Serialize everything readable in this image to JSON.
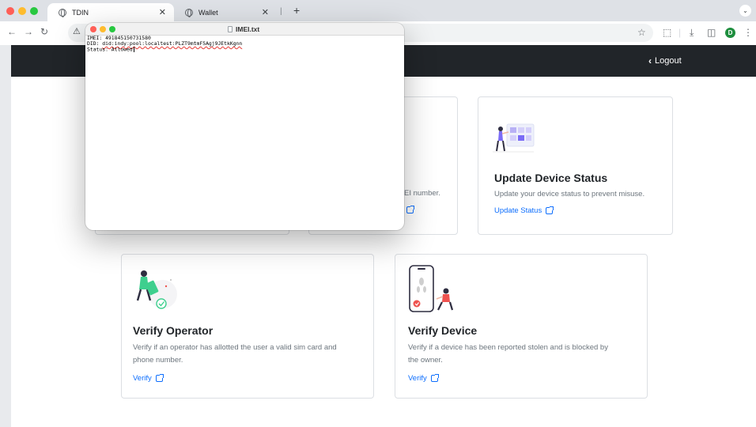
{
  "browser": {
    "tabs": [
      {
        "label": "TDIN",
        "active": true
      },
      {
        "label": "Wallet",
        "active": false
      }
    ],
    "address_warning_icon": "warning-icon",
    "profile_initial": "D"
  },
  "page": {
    "navbar": {
      "logout_label": "Logout"
    },
    "cards": {
      "update_status": {
        "title": "Update Device Status",
        "text": "Update your device status to prevent misuse.",
        "link": "Update Status"
      },
      "partial": {
        "text": "EI number."
      },
      "verify_operator": {
        "title": "Verify Operator",
        "text_line1": "Verify if an operator has allotted the user a valid sim card and",
        "text_line2": "phone number.",
        "link": "Verify"
      },
      "verify_device": {
        "title": "Verify Device",
        "text_line1": "Verify if a device has been reported stolen and is blocked by",
        "text_line2": "the owner.",
        "link": "Verify"
      }
    }
  },
  "textedit": {
    "title": "IMEI.txt",
    "lines": {
      "imei": "IMEI: 491845150731580",
      "did_prefix": "DID: ",
      "did_value": "did:indy:pool:localtest:PLZT9mtmF5Agj9JEtkKgnn",
      "status": "Status: Allowed"
    }
  },
  "colors": {
    "navbar": "#212529",
    "link": "#0d6efd",
    "accent_purple": "#7b6cf6",
    "accent_green": "#3ecf8e",
    "accent_red": "#ef5350"
  }
}
